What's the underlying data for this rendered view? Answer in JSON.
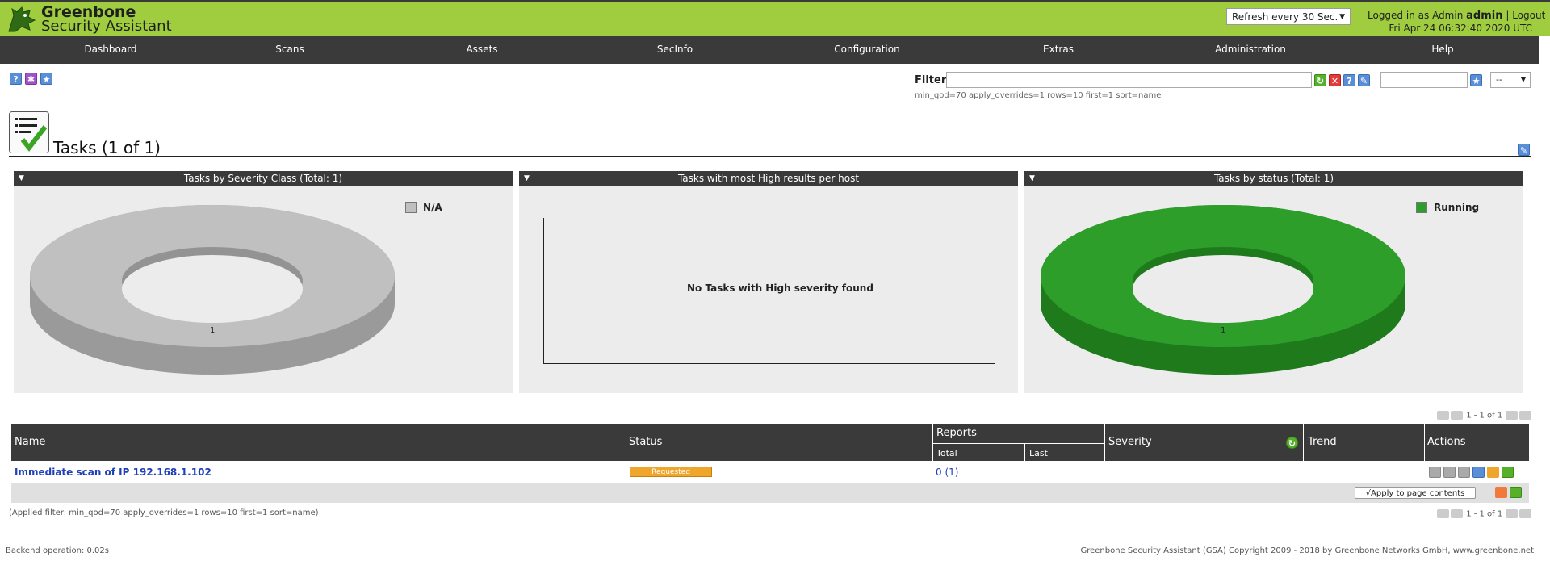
{
  "header": {
    "brand_line1": "Greenbone",
    "brand_line2": "Security Assistant",
    "refresh": "Refresh every 30 Sec.",
    "logged_in_prefix": "Logged in as",
    "role": "Admin",
    "username": "admin",
    "separator": "|",
    "logout": "Logout",
    "datetime": "Fri Apr 24 06:32:40 2020 UTC"
  },
  "nav": [
    "Dashboard",
    "Scans",
    "Assets",
    "SecInfo",
    "Configuration",
    "Extras",
    "Administration",
    "Help"
  ],
  "toolbar": {
    "filter_label": "Filter:",
    "filter_value": "",
    "filter_hint": "min_qod=70 apply_overrides=1 rows=10 first=1 sort=name",
    "select_value": "--"
  },
  "page": {
    "title": "Tasks (1 of 1)"
  },
  "panels": {
    "severity": {
      "title": "Tasks by Severity Class (Total: 1)",
      "legend": "N/A",
      "slice_label": "1"
    },
    "high": {
      "title": "Tasks with most High results per host",
      "empty": "No Tasks with High severity found"
    },
    "status": {
      "title": "Tasks by status (Total: 1)",
      "legend": "Running",
      "slice_label": "1"
    }
  },
  "colors": {
    "brand": "#9fcd3f",
    "na": "#c0c0c0",
    "running": "#2e9e2a",
    "status_requested": "#f0a52b"
  },
  "pager": {
    "text": "1 - 1 of 1"
  },
  "table": {
    "headers": {
      "name": "Name",
      "status": "Status",
      "reports": "Reports",
      "total": "Total",
      "last": "Last",
      "severity": "Severity",
      "trend": "Trend",
      "actions": "Actions"
    },
    "rows": [
      {
        "name": "Immediate scan of IP 192.168.1.102",
        "status": "Requested",
        "reports_total": "0 (1)",
        "last": "",
        "severity": "",
        "trend": ""
      }
    ],
    "apply_select": "√Apply to page contents"
  },
  "footer": {
    "applied_filter": "(Applied filter: min_qod=70 apply_overrides=1 rows=10 first=1 sort=name)",
    "backend": "Backend operation: 0.02s",
    "copyright": "Greenbone Security Assistant (GSA) Copyright 2009 - 2018 by Greenbone Networks GmbH, www.greenbone.net"
  }
}
